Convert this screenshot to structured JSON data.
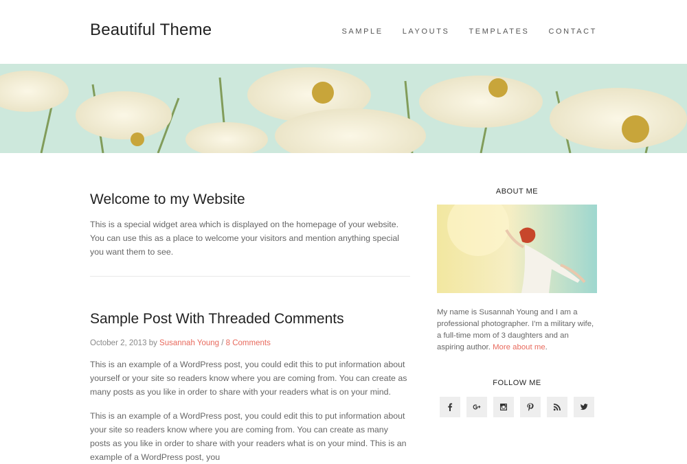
{
  "header": {
    "site_title": "Beautiful Theme",
    "nav": [
      "SAMPLE",
      "LAYOUTS",
      "TEMPLATES",
      "CONTACT"
    ]
  },
  "welcome": {
    "title": "Welcome to my Website",
    "text": "This is a special widget area which is displayed on the homepage of your website. You can use this as a place to welcome your visitors and mention anything special you want them to see."
  },
  "post": {
    "title": "Sample Post With Threaded Comments",
    "date": "October 2, 2013",
    "by": "by",
    "author": "Susannah Young",
    "sep": "/",
    "comments": "8 Comments",
    "paragraphs": [
      "This is an example of a WordPress post, you could edit this to put information about yourself or your site so readers know where you are coming from. You can create as many posts as you like in order to share with your readers what is on your mind.",
      "This is an example of a WordPress post, you could edit this to put information about your site so readers know where you are coming from. You can create as many posts as you like in order to share with your readers what is on your mind. This is an example of a WordPress post, you"
    ]
  },
  "sidebar": {
    "about_heading": "ABOUT ME",
    "about_text": "My name is Susannah Young and I am a professional photographer. I'm a military wife, a full-time mom of 3 daughters and an aspiring author.",
    "about_link": "More about me",
    "about_end": ".",
    "follow_heading": "FOLLOW ME",
    "social": [
      "facebook-icon",
      "google-plus-icon",
      "instagram-icon",
      "pinterest-icon",
      "rss-icon",
      "twitter-icon"
    ]
  },
  "colors": {
    "accent": "#e86a5d",
    "social_bg": "#eeeeee"
  }
}
